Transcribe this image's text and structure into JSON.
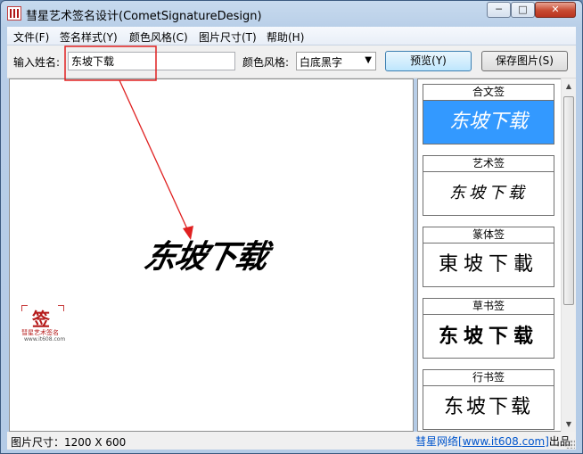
{
  "window": {
    "title": "彗星艺术签名设计(CometSignatureDesign)",
    "minimize_symbol": "─",
    "maximize_symbol": "□",
    "close_symbol": "✕"
  },
  "menu": [
    {
      "label": "文件(F)"
    },
    {
      "label": "签名样式(Y)"
    },
    {
      "label": "颜色风格(C)"
    },
    {
      "label": "图片尺寸(T)"
    },
    {
      "label": "帮助(H)"
    }
  ],
  "toolbar": {
    "name_label": "输入姓名:",
    "name_value": "东坡下载",
    "color_label": "颜色风格:",
    "color_value": "白底黑字",
    "preview_button": "预览(Y)",
    "save_button": "保存图片(S)"
  },
  "canvas": {
    "signature_text": "东坡下载",
    "logo": {
      "caption": "彗星艺术签名",
      "url": "www.it608.com",
      "mark": "签"
    }
  },
  "styles": {
    "items": [
      {
        "title": "合文签",
        "sample": "东坡下载",
        "selected": true
      },
      {
        "title": "艺术签",
        "sample": "东坡下载",
        "selected": false
      },
      {
        "title": "篆体签",
        "sample": "東坡下載",
        "selected": false
      },
      {
        "title": "草书签",
        "sample": "东坡下载",
        "selected": false
      },
      {
        "title": "行书签",
        "sample": "东坡下载",
        "selected": false
      }
    ]
  },
  "statusbar": {
    "left": "图片尺寸：1200 X 600",
    "right_prefix": "彗星网络",
    "right_link": "[www.it608.com]",
    "right_suffix": "出品"
  },
  "colors": {
    "selected_card": "#3399ff",
    "annotation_red": "#e02020",
    "close_button": "#c84a31"
  }
}
